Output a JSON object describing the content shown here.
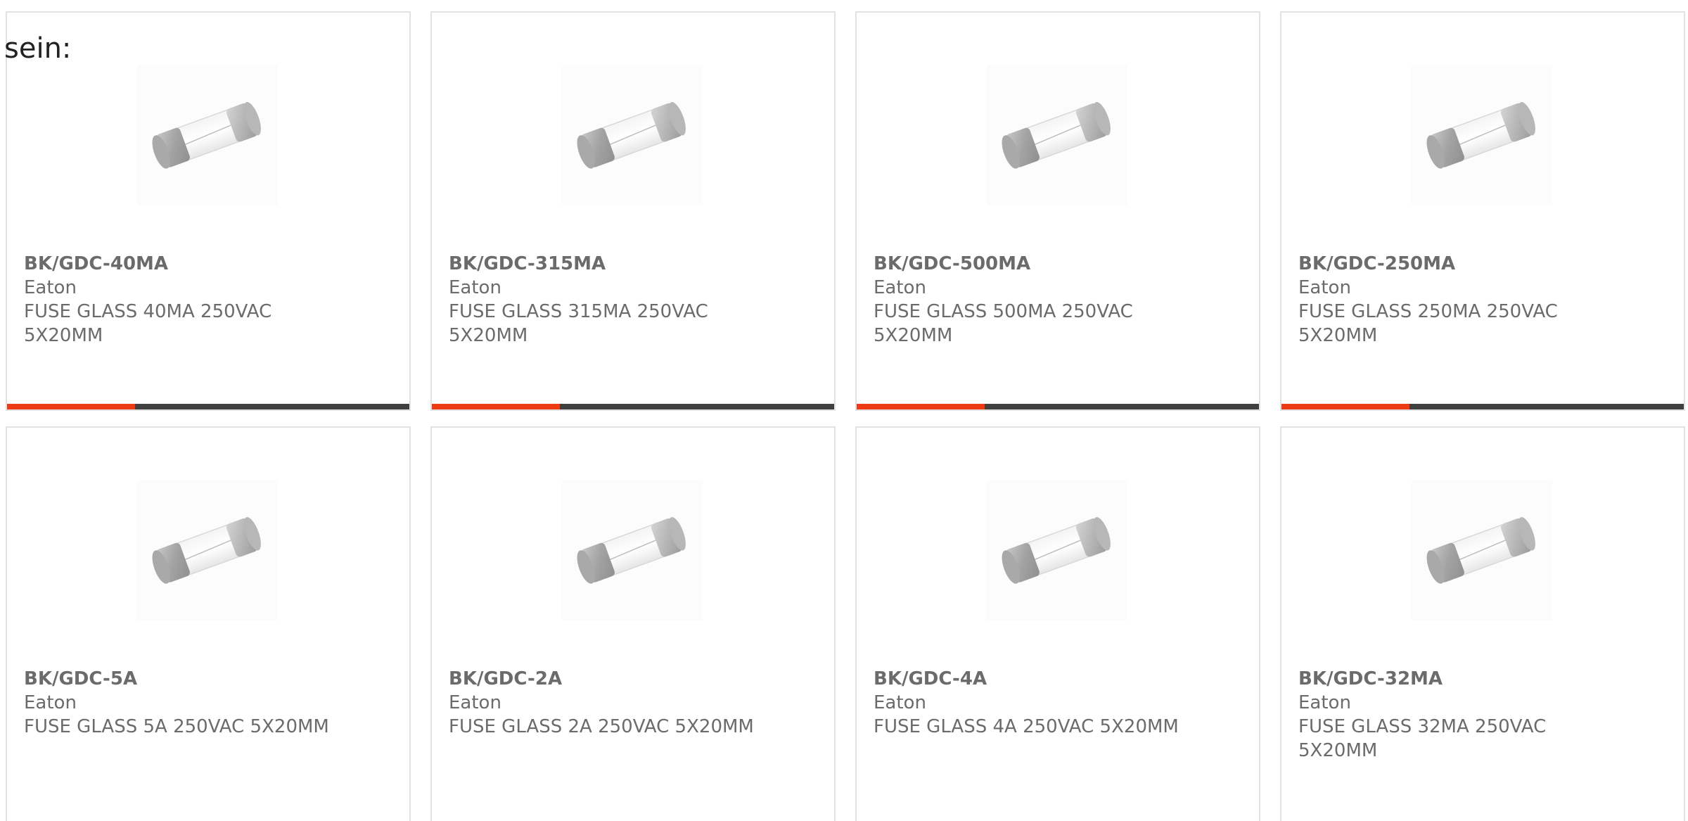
{
  "intro_text": "sein:",
  "accent_color": "#ee3b12",
  "bar_color": "#404040",
  "products": [
    {
      "part": "BK/GDC-40MA",
      "brand": "Eaton",
      "description": "FUSE GLASS 40MA 250VAC 5X20MM",
      "image_icon": "glass-fuse-icon"
    },
    {
      "part": "BK/GDC-315MA",
      "brand": "Eaton",
      "description": "FUSE GLASS 315MA 250VAC 5X20MM",
      "image_icon": "glass-fuse-icon"
    },
    {
      "part": "BK/GDC-500MA",
      "brand": "Eaton",
      "description": "FUSE GLASS 500MA 250VAC 5X20MM",
      "image_icon": "glass-fuse-icon"
    },
    {
      "part": "BK/GDC-250MA",
      "brand": "Eaton",
      "description": "FUSE GLASS 250MA 250VAC 5X20MM",
      "image_icon": "glass-fuse-icon"
    },
    {
      "part": "BK/GDC-5A",
      "brand": "Eaton",
      "description": "FUSE GLASS 5A 250VAC 5X20MM",
      "image_icon": "glass-fuse-icon"
    },
    {
      "part": "BK/GDC-2A",
      "brand": "Eaton",
      "description": "FUSE GLASS 2A 250VAC 5X20MM",
      "image_icon": "glass-fuse-icon"
    },
    {
      "part": "BK/GDC-4A",
      "brand": "Eaton",
      "description": "FUSE GLASS 4A 250VAC 5X20MM",
      "image_icon": "glass-fuse-icon"
    },
    {
      "part": "BK/GDC-32MA",
      "brand": "Eaton",
      "description": "FUSE GLASS 32MA 250VAC 5X20MM",
      "image_icon": "glass-fuse-icon"
    }
  ]
}
